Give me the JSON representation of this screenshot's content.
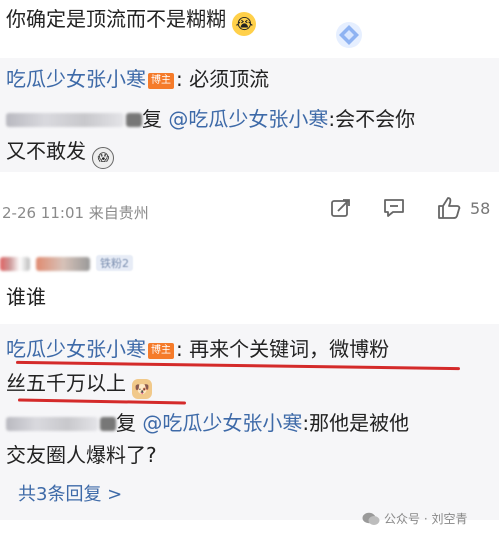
{
  "comment1": {
    "text": "你确定是顶流而不是糊糊",
    "reply1": {
      "author": "吃瓜少女张小寒",
      "badge": "博主",
      "text": ": 必须顶流"
    },
    "reply2": {
      "reply_word": "复",
      "mention": "@吃瓜少女张小寒",
      "text_line1": ":会不会你",
      "text_line2": "又不敢发"
    },
    "time": "2-26 11:01 来自贵州",
    "likes": "58"
  },
  "comment2": {
    "user_tag": "铁粉2",
    "text": "谁谁",
    "reply1": {
      "author": "吃瓜少女张小寒",
      "badge": "博主",
      "text_line1": ": 再来个关键词，微博粉",
      "text_line2": "丝五千万以上"
    },
    "reply2": {
      "reply_word": "复",
      "mention": "@吃瓜少女张小寒",
      "text_line1": ":那他是被他",
      "text_line2": "交友圈人爆料了?"
    },
    "more_replies": "共3条回复 >"
  },
  "watermark": "公众号 · 刘空青",
  "colors": {
    "link": "#3e6aa8",
    "highlight": "#d42a2a",
    "badge": "#f57b2a"
  },
  "icons": [
    "crying-face-emoji",
    "diamond-sticker",
    "shocked-face-emoji",
    "share-icon",
    "comment-icon",
    "like-icon",
    "doge-emoji",
    "wechat-icon"
  ]
}
